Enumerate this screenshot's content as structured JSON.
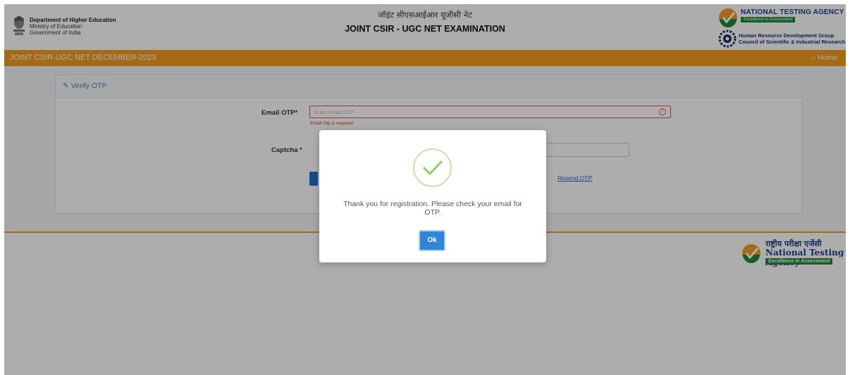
{
  "header": {
    "dept_name": "Department of Higher Education",
    "ministry": "Ministry of Education",
    "government": "Government of India",
    "title_hindi": "जॉइंट सीएसआईआर यूजीसी नेट",
    "title_english": "JOINT CSIR - UGC NET EXAMINATION",
    "nta_name": "NATIONAL TESTING AGENCY",
    "nta_tagline": "Excellence in Assessment",
    "csir_line1": "Human Resource Development Group",
    "csir_line2": "Council of Scientific & Industrial Research"
  },
  "navbar": {
    "title": "JOINT CSIR-UGC NET DECEMBER-2023",
    "home_label": "Home"
  },
  "panel": {
    "heading": "Verify OTP",
    "email_otp_label": "Email OTP",
    "email_otp_placeholder": "Enter Email OTP",
    "email_otp_error": "Email Otp is required",
    "captcha_label": "Captcha",
    "resend_label": "Resend OTP"
  },
  "footer": {
    "hindi": "राष्ट्रीय परीक्षा एजेंसी",
    "english": "National Testing Agency",
    "tagline": "Excellence in Assessment"
  },
  "modal": {
    "message": "Thank you for registration. Please check your email for OTP.",
    "ok_label": "Ok"
  },
  "colors": {
    "accent_orange": "#f39c1f",
    "link_blue": "#2465c5",
    "error_red": "#d9534f",
    "ok_button": "#3085d6",
    "success_green": "#8dd06b"
  }
}
